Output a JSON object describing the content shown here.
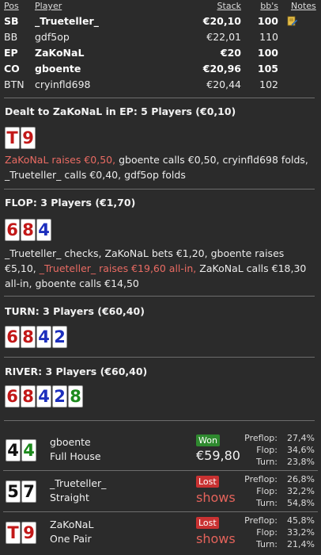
{
  "header": {
    "pos_label": "Pos",
    "player_label": "Player",
    "stack_label": "Stack",
    "bb_label": "bb's",
    "notes_label": "Notes"
  },
  "players": [
    {
      "pos": "SB",
      "name": "_Trueteller_",
      "stack": "€20,10",
      "bb": "100",
      "bold": true,
      "note": true
    },
    {
      "pos": "BB",
      "name": "gdf5op",
      "stack": "€22,01",
      "bb": "110",
      "bold": false,
      "note": false
    },
    {
      "pos": "EP",
      "name": "ZaKoNaL",
      "stack": "€20",
      "bb": "100",
      "bold": true,
      "note": false
    },
    {
      "pos": "CO",
      "name": "gboente",
      "stack": "€20,96",
      "bb": "105",
      "bold": true,
      "note": false
    },
    {
      "pos": "BTN",
      "name": "cryinfld698",
      "stack": "€20,44",
      "bb": "102",
      "bold": false,
      "note": false
    }
  ],
  "preflop": {
    "title": "Dealt to ZaKoNaL in EP: 5 Players (€0,10)",
    "cards": [
      {
        "r": "T",
        "s": "h"
      },
      {
        "r": "9",
        "s": "h"
      }
    ],
    "action_hl": "ZaKoNaL raises €0,50,",
    "action_rest": " gboente calls €0,50, cryinfld698 folds, _Trueteller_ calls €0,40, gdf5op folds"
  },
  "flop": {
    "title": "FLOP: 3 Players (€1,70)",
    "cards": [
      {
        "r": "6",
        "s": "h"
      },
      {
        "r": "8",
        "s": "h"
      },
      {
        "r": "4",
        "s": "d"
      }
    ],
    "action_a": "_Trueteller_ checks, ZaKoNaL bets €1,20, gboente raises €5,10, ",
    "action_hl": "_Trueteller_ raises €19,60 all-in,",
    "action_b": " ZaKoNaL calls €18,30 all-in, gboente calls €14,50"
  },
  "turn": {
    "title": "TURN: 3 Players (€60,40)",
    "cards": [
      {
        "r": "6",
        "s": "h"
      },
      {
        "r": "8",
        "s": "h"
      },
      {
        "r": "4",
        "s": "d"
      },
      {
        "r": "2",
        "s": "d"
      }
    ]
  },
  "river": {
    "title": "RIVER: 3 Players (€60,40)",
    "cards": [
      {
        "r": "6",
        "s": "h"
      },
      {
        "r": "8",
        "s": "h"
      },
      {
        "r": "4",
        "s": "d"
      },
      {
        "r": "2",
        "s": "d"
      },
      {
        "r": "8",
        "s": "c"
      }
    ]
  },
  "showdown": [
    {
      "cards": [
        {
          "r": "4",
          "s": "s"
        },
        {
          "r": "4",
          "s": "c"
        }
      ],
      "name": "gboente",
      "hand": "Full House",
      "result": "Won",
      "result_type": "won",
      "amount": "€59,80",
      "shows": "",
      "equity": [
        {
          "k": "Preflop:",
          "v": "27,4%"
        },
        {
          "k": "Flop:",
          "v": "34,6%"
        },
        {
          "k": "Turn:",
          "v": "23,8%"
        }
      ]
    },
    {
      "cards": [
        {
          "r": "5",
          "s": "s"
        },
        {
          "r": "7",
          "s": "s"
        }
      ],
      "name": "_Trueteller_",
      "hand": "Straight",
      "result": "Lost",
      "result_type": "lost",
      "amount": "",
      "shows": "shows",
      "equity": [
        {
          "k": "Preflop:",
          "v": "26,8%"
        },
        {
          "k": "Flop:",
          "v": "32,2%"
        },
        {
          "k": "Turn:",
          "v": "54,8%"
        }
      ]
    },
    {
      "cards": [
        {
          "r": "T",
          "s": "h"
        },
        {
          "r": "9",
          "s": "h"
        }
      ],
      "name": "ZaKoNaL",
      "hand": "One Pair",
      "result": "Lost",
      "result_type": "lost",
      "amount": "",
      "shows": "shows",
      "equity": [
        {
          "k": "Preflop:",
          "v": "45,8%"
        },
        {
          "k": "Flop:",
          "v": "33,2%"
        },
        {
          "k": "Turn:",
          "v": "21,4%"
        }
      ]
    }
  ],
  "colors": {
    "hearts": "#c21818",
    "diamonds": "#1d2fbd",
    "clubs": "#1d8a1d",
    "spades": "#111111",
    "highlight": "#e96b63"
  }
}
